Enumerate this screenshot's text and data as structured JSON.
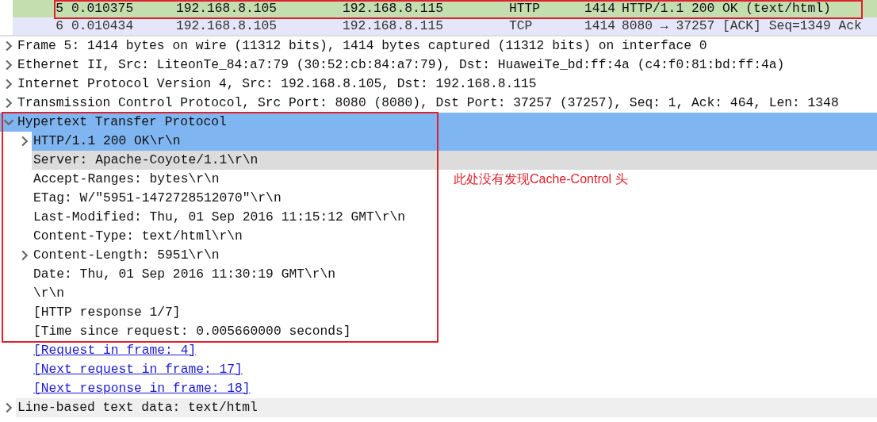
{
  "packet_list": {
    "rows": [
      {
        "no": "5",
        "time": "0.010375",
        "source": "192.168.8.105",
        "destination": "192.168.8.115",
        "protocol": "HTTP",
        "length": "1414",
        "info": "HTTP/1.1 200 OK  (text/html)",
        "selected": true,
        "boxed": true
      },
      {
        "no": "6",
        "time": "0.010434",
        "source": "192.168.8.105",
        "destination": "192.168.8.115",
        "protocol": "TCP",
        "length": "1414",
        "info": "8080 → 37257 [ACK] Seq=1349 Ack",
        "selected": false,
        "boxed": false
      }
    ]
  },
  "details": {
    "items": [
      {
        "kind": "node",
        "label": "Frame 5: 1414 bytes on wire (11312 bits), 1414 bytes captured (11312 bits) on interface 0",
        "expanded": false,
        "selected": false,
        "hovered": false,
        "shaded": false,
        "boxed": false
      },
      {
        "kind": "node",
        "label": "Ethernet II, Src: LiteonTe_84:a7:79 (30:52:cb:84:a7:79), Dst: HuaweiTe_bd:ff:4a (c4:f0:81:bd:ff:4a)",
        "expanded": false,
        "selected": false,
        "hovered": false,
        "shaded": false,
        "boxed": false
      },
      {
        "kind": "node",
        "label": "Internet Protocol Version 4, Src: 192.168.8.105, Dst: 192.168.8.115",
        "expanded": false,
        "selected": false,
        "hovered": false,
        "shaded": false,
        "boxed": false
      },
      {
        "kind": "node",
        "label": "Transmission Control Protocol, Src Port: 8080 (8080), Dst Port: 37257 (37257), Seq: 1, Ack: 464, Len: 1348",
        "expanded": false,
        "selected": false,
        "hovered": false,
        "shaded": false,
        "boxed": false
      },
      {
        "kind": "node",
        "label": "Hypertext Transfer Protocol",
        "expanded": true,
        "selected": true,
        "boxed": true,
        "children": [
          {
            "kind": "node",
            "label": "HTTP/1.1 200 OK\\r\\n",
            "expanded": false,
            "selected": true
          },
          {
            "kind": "field",
            "label": "Server: Apache-Coyote/1.1\\r\\n",
            "selected": false,
            "hovered": true
          },
          {
            "kind": "field",
            "label": "Accept-Ranges: bytes\\r\\n",
            "selected": false,
            "hovered": false,
            "shaded": false,
            "note": "此处没有发现Cache-Control 头"
          },
          {
            "kind": "field",
            "label": "ETag: W/\"5951-1472728512070\"\\r\\n",
            "selected": false,
            "hovered": false,
            "shaded": false
          },
          {
            "kind": "field",
            "label": "Last-Modified: Thu, 01 Sep 2016 11:15:12 GMT\\r\\n",
            "selected": false,
            "hovered": false,
            "shaded": false
          },
          {
            "kind": "field",
            "label": "Content-Type: text/html\\r\\n",
            "selected": false,
            "hovered": false,
            "shaded": false
          },
          {
            "kind": "node",
            "label": "Content-Length: 5951\\r\\n",
            "expanded": false,
            "selected": false,
            "hovered": false,
            "shaded": false
          },
          {
            "kind": "field",
            "label": "Date: Thu, 01 Sep 2016 11:30:19 GMT\\r\\n",
            "selected": false,
            "hovered": false,
            "shaded": false
          },
          {
            "kind": "field",
            "label": "\\r\\n",
            "selected": false,
            "hovered": false,
            "shaded": false
          },
          {
            "kind": "field",
            "label": "[HTTP response 1/7]",
            "selected": false,
            "hovered": false,
            "shaded": false
          },
          {
            "kind": "field",
            "label": "[Time since request: 0.005660000 seconds]",
            "selected": false,
            "hovered": false,
            "shaded": false
          },
          {
            "kind": "link",
            "label": "[Request in frame: 4]",
            "selected": false,
            "hovered": false,
            "shaded": false
          },
          {
            "kind": "link",
            "label": "[Next request in frame: 17]",
            "selected": false,
            "hovered": false,
            "shaded": false
          },
          {
            "kind": "link",
            "label": "[Next response in frame: 18]",
            "selected": false,
            "hovered": false,
            "shaded": false
          }
        ]
      },
      {
        "kind": "node",
        "label": "Line-based text data: text/html",
        "expanded": false,
        "selected": false,
        "hovered": false,
        "shaded": true,
        "boxed": false
      }
    ]
  }
}
